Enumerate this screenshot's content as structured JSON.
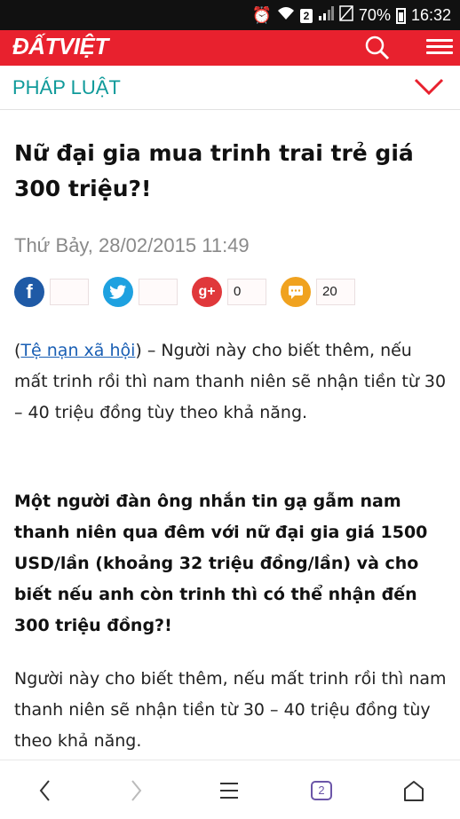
{
  "status_bar": {
    "time": "16:32",
    "battery": "70%",
    "sim_badge": "2"
  },
  "header": {
    "logo": "ĐẤTVIỆT",
    "brand_color": "#e8212e"
  },
  "category": {
    "label": "PHÁP LUẬT",
    "color": "#0f9a9a"
  },
  "article": {
    "title": "Nữ đại gia mua trinh trai trẻ giá 300 triệu?!",
    "date": "Thứ Bảy, 28/02/2015 11:49",
    "share": [
      {
        "icon": "facebook-icon",
        "glyph": "f",
        "color": "#1f5aa6",
        "count": ""
      },
      {
        "icon": "twitter-icon",
        "glyph": "🐦",
        "color": "#1ea1e0",
        "count": ""
      },
      {
        "icon": "google-plus-icon",
        "glyph": "g+",
        "color": "#e0383b",
        "count": "0"
      },
      {
        "icon": "comment-icon",
        "glyph": "💬",
        "color": "#f0a21f",
        "count": "20"
      }
    ],
    "intro_link": "Tệ nạn xã hội",
    "intro_text": " – Người này cho biết thêm, nếu mất trinh rồi thì nam thanh niên sẽ nhận tiền từ 30 – 40 triệu đồng tùy theo khả năng.",
    "lead": "Một người đàn ông nhắn tin gạ gẫm nam thanh niên qua đêm với nữ đại gia giá 1500 USD/lần (khoảng 32 triệu đồng/lần) và cho biết nếu anh còn trinh thì có thể nhận đến 300 triệu đồng?!",
    "paragraph": "Người này cho biết thêm, nếu mất trinh rồi thì nam thanh niên sẽ nhận tiền từ 30 – 40 triệu đồng tùy theo khả năng."
  },
  "bottom_nav": {
    "back": "‹",
    "forward": "›",
    "menu": "☰",
    "tabs_count": "2",
    "home": "⌂"
  }
}
